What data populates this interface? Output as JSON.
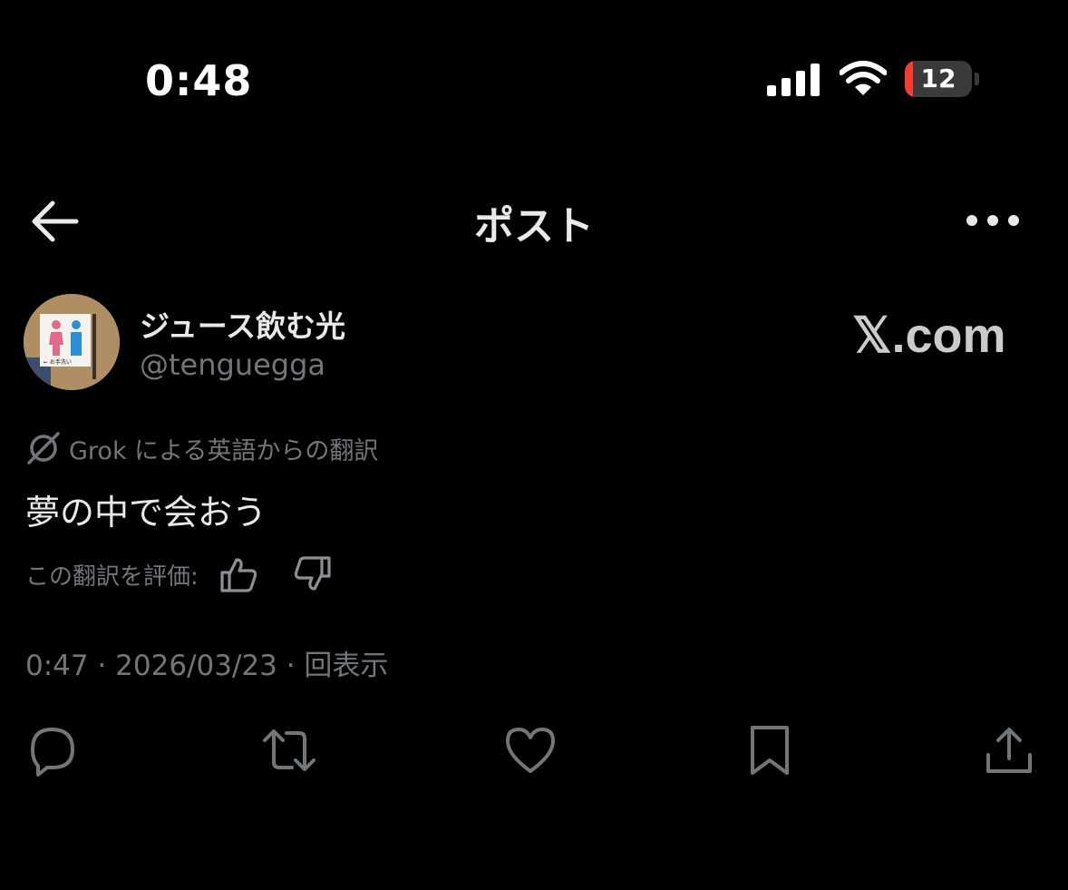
{
  "status_bar": {
    "time": "0:48",
    "battery_level": "12",
    "battery_fraction": 0.12
  },
  "header": {
    "title": "ポスト",
    "back_icon": "arrow-left-icon",
    "more_icon": "more-horizontal-icon"
  },
  "author": {
    "display_name": "ジュース飲む光",
    "handle": "@tenguegga",
    "avatar_sign_text": "← お手洗い"
  },
  "watermark": "𝕏.com",
  "translation": {
    "label": "Grok による英語からの翻訳",
    "icon": "grok-icon"
  },
  "post": {
    "text": "夢の中で会おう"
  },
  "rating": {
    "label": "この翻訳を評価:",
    "up_icon": "thumbs-up-icon",
    "down_icon": "thumbs-down-icon"
  },
  "meta": {
    "line": "0:47 · 2026/03/23 · 回表示"
  },
  "actions": {
    "icons": [
      "reply-icon",
      "repost-icon",
      "like-icon",
      "bookmark-icon",
      "share-icon"
    ]
  },
  "colors": {
    "background": "#000000",
    "text_primary": "#e7e9ea",
    "text_secondary": "#71767b",
    "battery_low": "#ff3b30"
  }
}
